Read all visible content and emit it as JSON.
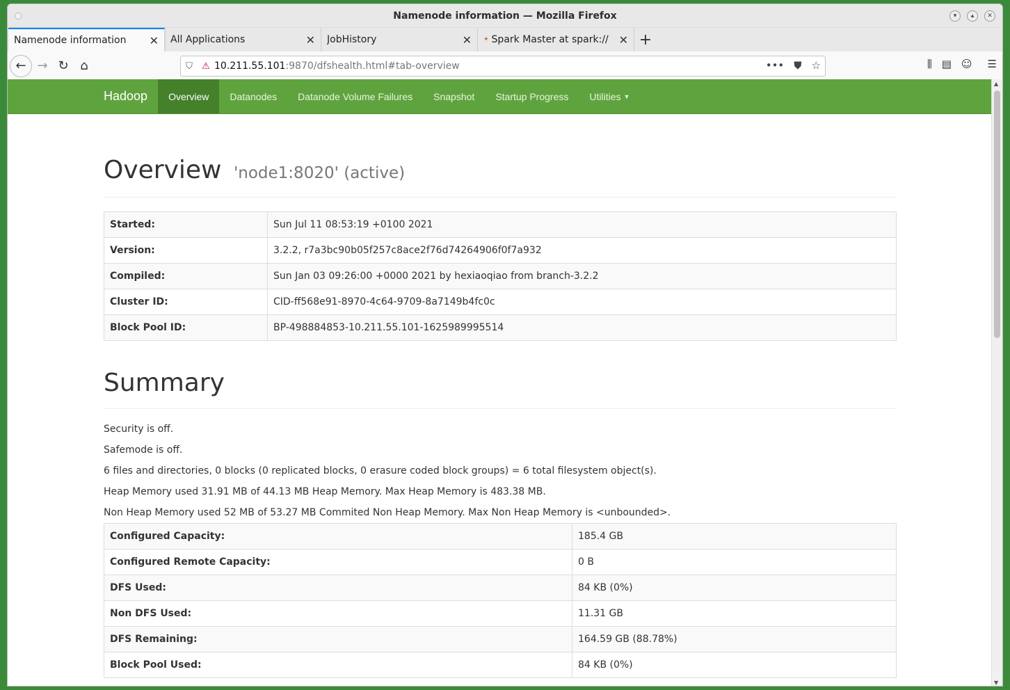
{
  "window": {
    "title": "Namenode information — Mozilla Firefox"
  },
  "tabs": [
    {
      "label": "Namenode information",
      "active": true
    },
    {
      "label": "All Applications"
    },
    {
      "label": "JobHistory"
    },
    {
      "label": "Spark Master at spark://",
      "favicon": "spark"
    }
  ],
  "url": {
    "host": "10.211.55.101",
    "path": ":9870/dfshealth.html#tab-overview"
  },
  "hadoop_nav": {
    "brand": "Hadoop",
    "items": [
      "Overview",
      "Datanodes",
      "Datanode Volume Failures",
      "Snapshot",
      "Startup Progress",
      "Utilities"
    ]
  },
  "overview": {
    "title": "Overview",
    "subtitle": "'node1:8020' (active)",
    "rows": [
      {
        "key": "Started:",
        "value": "Sun Jul 11 08:53:19 +0100 2021"
      },
      {
        "key": "Version:",
        "value": "3.2.2, r7a3bc90b05f257c8ace2f76d74264906f0f7a932"
      },
      {
        "key": "Compiled:",
        "value": "Sun Jan 03 09:26:00 +0000 2021 by hexiaoqiao from branch-3.2.2"
      },
      {
        "key": "Cluster ID:",
        "value": "CID-ff568e91-8970-4c64-9709-8a7149b4fc0c"
      },
      {
        "key": "Block Pool ID:",
        "value": "BP-498884853-10.211.55.101-1625989995514"
      }
    ]
  },
  "summary": {
    "title": "Summary",
    "lines": [
      "Security is off.",
      "Safemode is off.",
      "6 files and directories, 0 blocks (0 replicated blocks, 0 erasure coded block groups) = 6 total filesystem object(s).",
      "Heap Memory used 31.91 MB of 44.13 MB Heap Memory. Max Heap Memory is 483.38 MB.",
      "Non Heap Memory used 52 MB of 53.27 MB Commited Non Heap Memory. Max Non Heap Memory is <unbounded>."
    ],
    "rows": [
      {
        "key": "Configured Capacity:",
        "value": "185.4 GB"
      },
      {
        "key": "Configured Remote Capacity:",
        "value": "0 B"
      },
      {
        "key": "DFS Used:",
        "value": "84 KB (0%)"
      },
      {
        "key": "Non DFS Used:",
        "value": "11.31 GB"
      },
      {
        "key": "DFS Remaining:",
        "value": "164.59 GB (88.78%)"
      },
      {
        "key": "Block Pool Used:",
        "value": "84 KB (0%)"
      }
    ]
  }
}
